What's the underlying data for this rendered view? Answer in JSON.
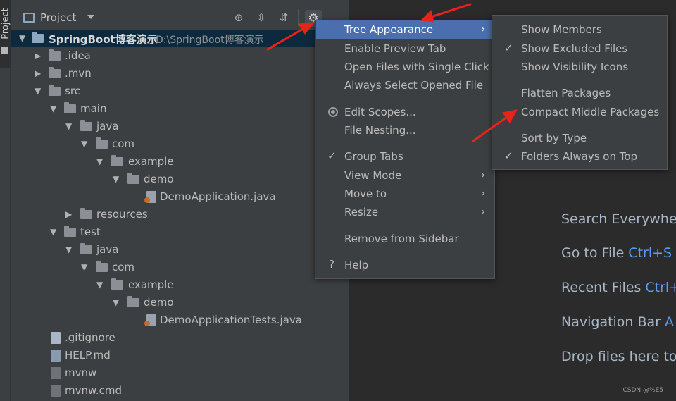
{
  "side_stripe": {
    "tab_label": "Project"
  },
  "project_panel": {
    "title": "Project",
    "toolbar_icons": [
      "crosshair-icon",
      "expand-all-icon",
      "collapse-all-icon",
      "gear-icon"
    ],
    "tree": [
      {
        "label": "SpringBoot博客演示",
        "path": "D:\\SpringBoot博客演示",
        "kind": "module",
        "expanded": true
      },
      {
        "label": ".idea",
        "kind": "folder",
        "expanded": false
      },
      {
        "label": ".mvn",
        "kind": "folder",
        "expanded": false
      },
      {
        "label": "src",
        "kind": "folder",
        "expanded": true
      },
      {
        "label": "main",
        "kind": "folder",
        "expanded": true
      },
      {
        "label": "java",
        "kind": "folder",
        "expanded": true
      },
      {
        "label": "com",
        "kind": "folder",
        "expanded": true
      },
      {
        "label": "example",
        "kind": "folder",
        "expanded": true
      },
      {
        "label": "demo",
        "kind": "folder",
        "expanded": true
      },
      {
        "label": "DemoApplication.java",
        "kind": "java-file"
      },
      {
        "label": "resources",
        "kind": "folder",
        "expanded": false
      },
      {
        "label": "test",
        "kind": "folder",
        "expanded": true
      },
      {
        "label": "java",
        "kind": "folder",
        "expanded": true
      },
      {
        "label": "com",
        "kind": "folder",
        "expanded": true
      },
      {
        "label": "example",
        "kind": "folder",
        "expanded": true
      },
      {
        "label": "demo",
        "kind": "folder",
        "expanded": true
      },
      {
        "label": "DemoApplicationTests.java",
        "kind": "java-file"
      },
      {
        "label": ".gitignore",
        "kind": "file"
      },
      {
        "label": "HELP.md",
        "kind": "md-file"
      },
      {
        "label": "mvnw",
        "kind": "script-file"
      },
      {
        "label": "mvnw.cmd",
        "kind": "script-file"
      }
    ]
  },
  "context_menu": {
    "items": [
      {
        "label": "Tree Appearance",
        "has_submenu": true,
        "highlighted": true
      },
      {
        "label": "Enable Preview Tab"
      },
      {
        "label": "Open Files with Single Click"
      },
      {
        "label": "Always Select Opened File"
      },
      {
        "label": "Edit Scopes...",
        "icon": "scope-icon"
      },
      {
        "label": "File Nesting..."
      },
      {
        "label": "Group Tabs",
        "checked": true
      },
      {
        "label": "View Mode",
        "has_submenu": true
      },
      {
        "label": "Move to",
        "has_submenu": true
      },
      {
        "label": "Resize",
        "has_submenu": true
      },
      {
        "label": "Remove from Sidebar"
      },
      {
        "label": "Help",
        "icon": "help-icon",
        "glyph": "?"
      }
    ]
  },
  "tree_appearance_submenu": {
    "items": [
      {
        "label": "Show Members"
      },
      {
        "label": "Show Excluded Files",
        "checked": true
      },
      {
        "label": "Show Visibility Icons"
      },
      {
        "label": "Flatten Packages"
      },
      {
        "label": "Compact Middle Packages"
      },
      {
        "label": "Sort by Type"
      },
      {
        "label": "Folders Always on Top",
        "checked": true
      }
    ]
  },
  "editor_hints": [
    {
      "label": "Search Everywhe",
      "shortcut": ""
    },
    {
      "label": "Go to File",
      "shortcut": "Ctrl+S"
    },
    {
      "label": "Recent Files",
      "shortcut": "Ctrl+"
    },
    {
      "label": "Navigation Bar",
      "shortcut": "A"
    },
    {
      "label": "Drop files here to",
      "shortcut": ""
    }
  ],
  "watermark": "CSDN @%E5",
  "colors": {
    "panel_bg": "#3c3f41",
    "editor_bg": "#2b2b2b",
    "selection_bg": "#0d293e",
    "menu_highlight": "#4b6eaf",
    "shortcut_blue": "#589df6",
    "annotation_red": "#e8231a"
  }
}
